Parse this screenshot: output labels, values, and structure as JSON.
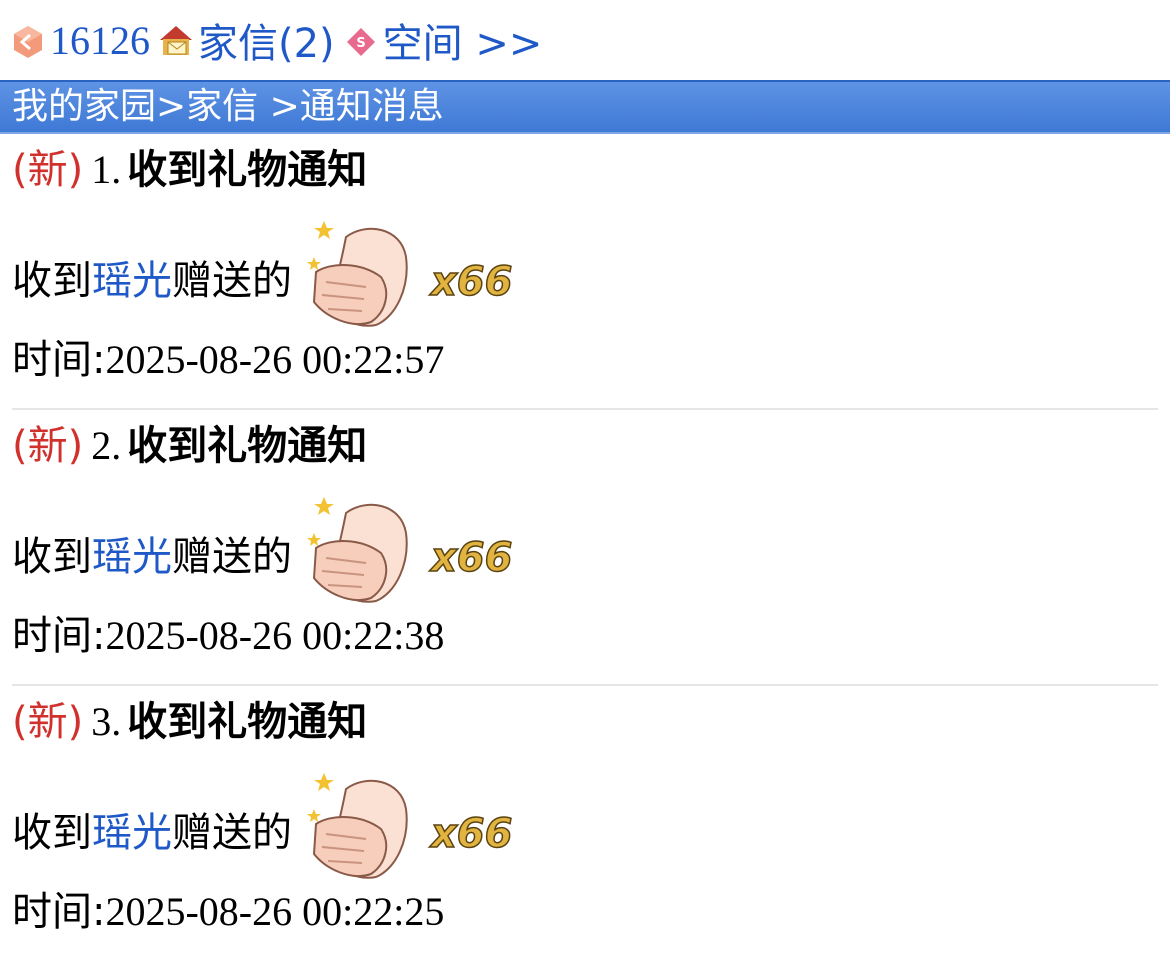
{
  "top_nav": {
    "user_id": "16126",
    "mail_label": "家信(2)",
    "space_label": "空间 >>"
  },
  "breadcrumb": "我的家园>家信 >通知消息",
  "notifications": [
    {
      "new_tag": "(新)",
      "number": "1.",
      "title": "收到礼物通知",
      "prefix": "收到",
      "sender": "瑶光",
      "suffix": "赠送的",
      "gift_icon": "clapping-hands-icon",
      "gift_quantity": "x66",
      "time_label": "时间:",
      "time_value": "2025-08-26 00:22:57"
    },
    {
      "new_tag": "(新)",
      "number": "2.",
      "title": "收到礼物通知",
      "prefix": "收到",
      "sender": "瑶光",
      "suffix": "赠送的",
      "gift_icon": "clapping-hands-icon",
      "gift_quantity": "x66",
      "time_label": "时间:",
      "time_value": "2025-08-26 00:22:38"
    },
    {
      "new_tag": "(新)",
      "number": "3.",
      "title": "收到礼物通知",
      "prefix": "收到",
      "sender": "瑶光",
      "suffix": "赠送的",
      "gift_icon": "clapping-hands-icon",
      "gift_quantity": "x66",
      "time_label": "时间:",
      "time_value": "2025-08-26 00:22:25"
    }
  ],
  "colors": {
    "link": "#1f58c7",
    "new_tag": "#d0312d",
    "nav_bar": "#4a82dc"
  }
}
